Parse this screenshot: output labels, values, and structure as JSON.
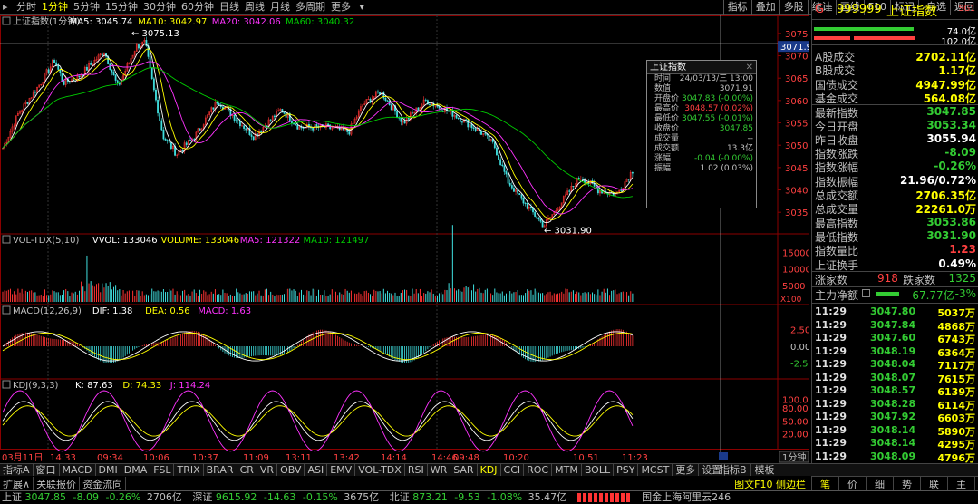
{
  "topbar": {
    "periods": [
      "分时",
      "1分钟",
      "5分钟",
      "15分钟",
      "30分钟",
      "60分钟",
      "日线",
      "周线",
      "月线",
      "多周期",
      "更多"
    ],
    "active_index": 1,
    "right_tools": [
      "指标",
      "叠加",
      "多股",
      "统计",
      "画线",
      "F10",
      "标记",
      "-自选",
      "返回"
    ]
  },
  "main": {
    "title": "上证指数(1分钟)",
    "ma_labels": [
      {
        "text": "MA5: 3045.74",
        "color": "#ffffff"
      },
      {
        "text": "MA10: 3042.97",
        "color": "#ffff00"
      },
      {
        "text": "MA20: 3042.06",
        "color": "#ff33ff"
      },
      {
        "text": "MA60: 3040.32",
        "color": "#00cc00"
      }
    ],
    "price_axis": [
      "3075",
      "3070",
      "3065",
      "3060",
      "3055",
      "3050",
      "3045",
      "3040",
      "3035"
    ],
    "cursor_price": "3071.9",
    "high_label": "3075.13",
    "low_label": "3031.90"
  },
  "vol": {
    "title": "VOL-TDX(5,10)",
    "labels": [
      {
        "text": "VVOL: 133046",
        "color": "#ffffff"
      },
      {
        "text": "VOLUME: 133046",
        "color": "#ffff00"
      },
      {
        "text": "MA5: 121322",
        "color": "#ff33ff"
      },
      {
        "text": "MA10: 121497",
        "color": "#00cc00"
      }
    ],
    "axis": [
      "15000",
      "10000",
      "5000"
    ],
    "unit": "X100"
  },
  "macd": {
    "title": "MACD(12,26,9)",
    "labels": [
      {
        "text": "DIF: 1.38",
        "color": "#ffffff"
      },
      {
        "text": "DEA: 0.56",
        "color": "#ffff00"
      },
      {
        "text": "MACD: 1.63",
        "color": "#ff33ff"
      }
    ],
    "axis": [
      "2.50",
      "0.00",
      "-2.50"
    ]
  },
  "kdj": {
    "title": "KDJ(9,3,3)",
    "labels": [
      {
        "text": "K: 87.63",
        "color": "#ffffff"
      },
      {
        "text": "D: 74.33",
        "color": "#ffff00"
      },
      {
        "text": "J: 114.24",
        "color": "#ff33ff"
      }
    ],
    "axis": [
      "100.00",
      "80.00",
      "50.00",
      "20.00"
    ]
  },
  "time_axis": [
    "03月11日",
    "14:33",
    "09:34",
    "10:06",
    "10:37",
    "11:09",
    "13:11",
    "13:42",
    "14:14",
    "14:46",
    "09:48",
    "10:20",
    "10:51",
    "11:23"
  ],
  "period_label": "1分钟",
  "tooltip": {
    "title": "上证指数",
    "rows": [
      {
        "k": "时间",
        "v": "24/03/13/三 13:00",
        "c": "#c0c0c0"
      },
      {
        "k": "数值",
        "v": "3071.91",
        "c": "#c0c0c0"
      },
      {
        "k": "开盘价",
        "v": "3047.83 (-0.00%)",
        "c": "#33cc33"
      },
      {
        "k": "最高价",
        "v": "3048.57 (0.02%)",
        "c": "#ff4040"
      },
      {
        "k": "最低价",
        "v": "3047.55 (-0.01%)",
        "c": "#33cc33"
      },
      {
        "k": "收盘价",
        "v": "3047.85",
        "c": "#33cc33"
      },
      {
        "k": "成交量",
        "v": "--",
        "c": "#c0c0c0"
      },
      {
        "k": "成交额",
        "v": "13.3亿",
        "c": "#c0c0c0"
      },
      {
        "k": "涨幅",
        "v": "-0.04 (-0.00%)",
        "c": "#33cc33"
      },
      {
        "k": "振幅",
        "v": "1.02 (0.03%)",
        "c": "#c0c0c0"
      }
    ]
  },
  "right": {
    "code": "999999",
    "name": "上证指数",
    "badge": "SG1",
    "prefix": "G",
    "bar1_value": "74.0亿",
    "bar2_value": "102.0亿",
    "stats": [
      {
        "l": "A股成交",
        "v": "2702.11亿",
        "c": "#ffff00"
      },
      {
        "l": "B股成交",
        "v": "1.17亿",
        "c": "#ffff00"
      },
      {
        "l": "国债成交",
        "v": "4947.99亿",
        "c": "#ffff00"
      },
      {
        "l": "基金成交",
        "v": "564.08亿",
        "c": "#ffff00"
      },
      {
        "l": "最新指数",
        "v": "3047.85",
        "c": "#33cc33"
      },
      {
        "l": "今日开盘",
        "v": "3053.34",
        "c": "#33cc33"
      },
      {
        "l": "昨日收盘",
        "v": "3055.94",
        "c": "#ffffff"
      },
      {
        "l": "指数涨跌",
        "v": "-8.09",
        "c": "#33cc33"
      },
      {
        "l": "指数涨幅",
        "v": "-0.26%",
        "c": "#33cc33"
      },
      {
        "l": "指数振幅",
        "v": "21.96/0.72%",
        "c": "#ffffff"
      },
      {
        "l": "总成交额",
        "v": "2706.35亿",
        "c": "#ffff00"
      },
      {
        "l": "总成交量",
        "v": "22261.0万",
        "c": "#ffff00"
      },
      {
        "l": "最高指数",
        "v": "3053.86",
        "c": "#33cc33"
      },
      {
        "l": "最低指数",
        "v": "3031.90",
        "c": "#33cc33"
      },
      {
        "l": "指数量比",
        "v": "1.23",
        "c": "#ff4040"
      },
      {
        "l": "上证换手",
        "v": "0.49%",
        "c": "#ffffff"
      }
    ],
    "up_label": "涨家数",
    "up_value": "918",
    "down_label": "跌家数",
    "down_value": "1325",
    "flow_label": "主力净额",
    "flow_value": "-67.77亿",
    "flow_pct": "-3%",
    "ticks": [
      {
        "t": "11:29",
        "p": "3047.80",
        "q": "5037万"
      },
      {
        "t": "11:29",
        "p": "3047.84",
        "q": "4868万"
      },
      {
        "t": "11:29",
        "p": "3047.60",
        "q": "6743万"
      },
      {
        "t": "11:29",
        "p": "3048.19",
        "q": "6364万"
      },
      {
        "t": "11:29",
        "p": "3048.04",
        "q": "7117万"
      },
      {
        "t": "11:29",
        "p": "3048.07",
        "q": "7615万"
      },
      {
        "t": "11:29",
        "p": "3048.57",
        "q": "6139万"
      },
      {
        "t": "11:29",
        "p": "3048.28",
        "q": "6114万"
      },
      {
        "t": "11:29",
        "p": "3047.92",
        "q": "6603万"
      },
      {
        "t": "11:29",
        "p": "3048.14",
        "q": "5890万"
      },
      {
        "t": "11:29",
        "p": "3048.14",
        "q": "4295万"
      },
      {
        "t": "11:29",
        "p": "3048.09",
        "q": "4796万"
      },
      {
        "t": "11:30",
        "p": "3047.85",
        "q": "4328万"
      }
    ],
    "bottom_tabs": [
      "笔",
      "价",
      "细",
      "势",
      "联",
      "主"
    ]
  },
  "bottom_tabs": [
    "指标A",
    "窗口",
    "MACD",
    "DMI",
    "DMA",
    "FSL",
    "TRIX",
    "BRAR",
    "CR",
    "VR",
    "OBV",
    "ASI",
    "EMV",
    "VOL-TDX",
    "RSI",
    "WR",
    "SAR",
    "KDJ",
    "CCI",
    "ROC",
    "MTM",
    "BOLL",
    "PSY",
    "MCST",
    "更多",
    "设置"
  ],
  "bottom_selected": "KDJ",
  "bottom_right": [
    "指标B",
    "模板"
  ],
  "func_tabs": [
    "扩展∧",
    "关联报价",
    "资金流向"
  ],
  "func_right": "图文F10 侧边栏",
  "status": {
    "sh_label": "上证",
    "sh_value": "3047.85",
    "sh_chg": "-8.09",
    "sh_pct": "-0.26%",
    "sh_amt": "2706亿",
    "sz_label": "深证",
    "sz_value": "9615.92",
    "sz_chg": "-14.63",
    "sz_pct": "-0.15%",
    "sz_amt": "3675亿",
    "bz_label": "北证",
    "bz_value": "873.21",
    "bz_chg": "-9.53",
    "bz_pct": "-1.08%",
    "bz_amt": "35.47亿",
    "server": "国金上海阿里云246"
  },
  "colors": {
    "up": "#ff4040",
    "down": "#33cc33",
    "ma5": "#ffffff",
    "ma10": "#ffff00",
    "ma20": "#ff33ff",
    "ma60": "#00cc00",
    "kline_up": "#ff3333",
    "kline_down": "#40e0e0"
  }
}
